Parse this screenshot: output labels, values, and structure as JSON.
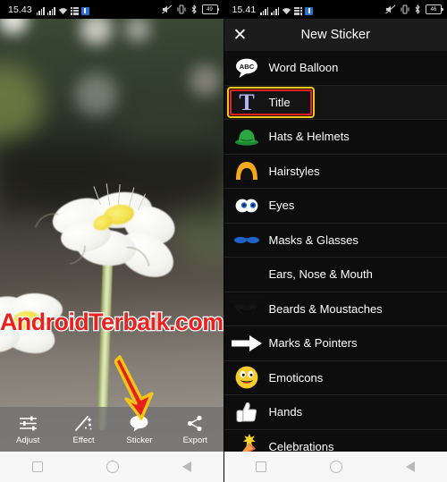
{
  "left_panel": {
    "status_bar": {
      "clock": "15.43",
      "battery_level": "49",
      "icons": [
        "signal-bars-sim1-icon",
        "signal-bars-sim2-icon",
        "wifi-icon",
        "grid-icon",
        "sim-badge-icon",
        "mute-icon",
        "vibrate-icon",
        "bluetooth-icon",
        "battery-icon"
      ]
    },
    "photo": {
      "alt": "white-flower-photo",
      "watermark": "AndroidTerbaik.com",
      "watermark_color": "#e8221f",
      "watermark_outline": "#ffffff"
    },
    "annotation": {
      "arrow": "down-arrow-annotation",
      "fill_color": "#e8201c",
      "stroke_color": "#f5c518",
      "points_to": "Sticker"
    },
    "toolbar": {
      "items": [
        {
          "label": "Adjust",
          "icon": "sliders-icon"
        },
        {
          "label": "Effect",
          "icon": "magic-wand-icon"
        },
        {
          "label": "Sticker",
          "icon": "speech-bubble-icon"
        },
        {
          "label": "Export",
          "icon": "share-icon"
        }
      ]
    },
    "nav_bar": {
      "items": [
        {
          "name": "recents-button",
          "icon": "square-icon"
        },
        {
          "name": "home-button",
          "icon": "circle-icon"
        },
        {
          "name": "back-button",
          "icon": "triangle-icon"
        }
      ]
    }
  },
  "right_panel": {
    "status_bar": {
      "clock": "15.41",
      "battery_level": "46"
    },
    "header": {
      "close_label": "✕",
      "title": "New Sticker"
    },
    "list": [
      {
        "label": "Word Balloon",
        "icon": "word-balloon-icon",
        "selected": false
      },
      {
        "label": "Title",
        "icon": "title-t-icon",
        "selected": true
      },
      {
        "label": "Hats & Helmets",
        "icon": "bowler-hat-icon",
        "selected": false
      },
      {
        "label": "Hairstyles",
        "icon": "hair-icon",
        "selected": false
      },
      {
        "label": "Eyes",
        "icon": "eyes-icon",
        "selected": false
      },
      {
        "label": "Masks & Glasses",
        "icon": "glasses-icon",
        "selected": false
      },
      {
        "label": "Ears, Nose & Mouth",
        "icon": "ears-nose-mouth-icon",
        "selected": false
      },
      {
        "label": "Beards & Moustaches",
        "icon": "moustache-icon",
        "selected": false
      },
      {
        "label": "Marks & Pointers",
        "icon": "arrow-pointer-icon",
        "selected": false
      },
      {
        "label": "Emoticons",
        "icon": "smiley-icon",
        "selected": false
      },
      {
        "label": "Hands",
        "icon": "thumbs-up-icon",
        "selected": false
      },
      {
        "label": "Celebrations",
        "icon": "party-popper-icon",
        "selected": false
      }
    ],
    "nav_bar": {
      "items": [
        {
          "name": "recents-button",
          "icon": "square-icon"
        },
        {
          "name": "home-button",
          "icon": "circle-icon"
        },
        {
          "name": "back-button",
          "icon": "triangle-icon"
        }
      ]
    }
  }
}
